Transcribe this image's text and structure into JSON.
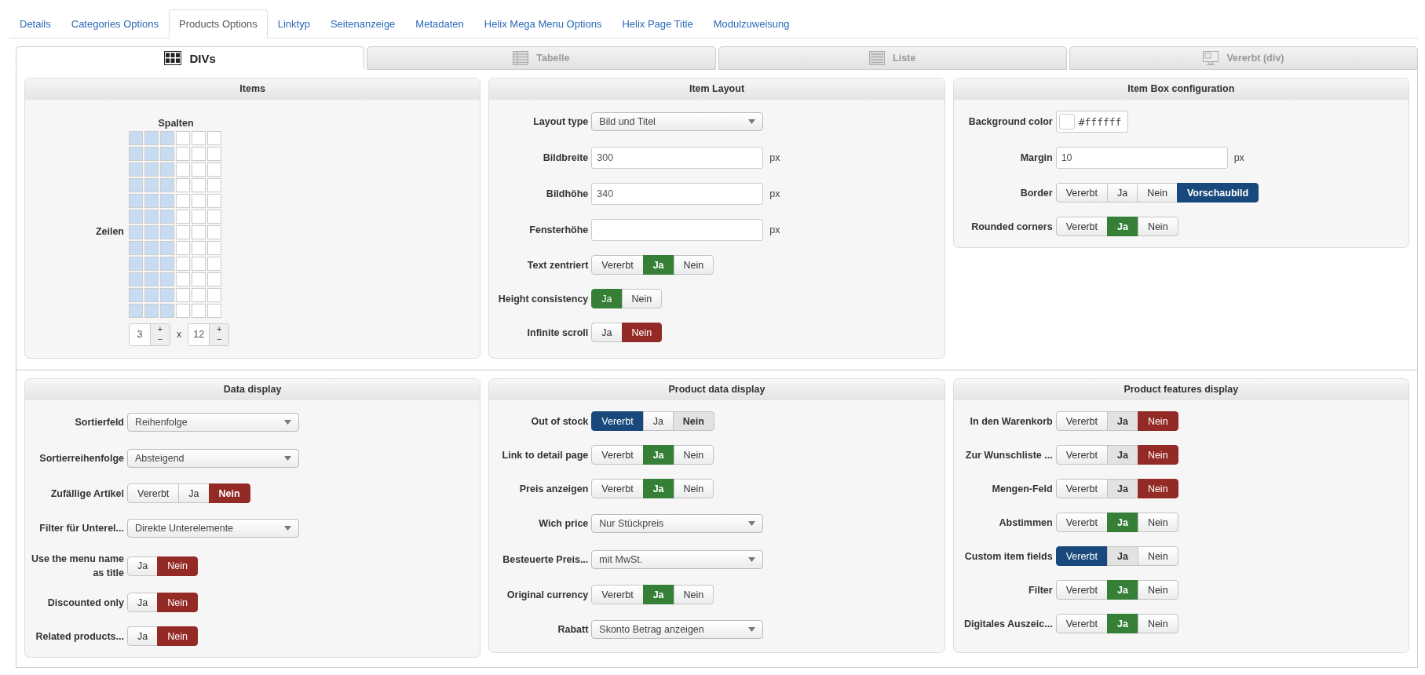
{
  "top_tabs": [
    {
      "label": "Details",
      "selected": false
    },
    {
      "label": "Categories Options",
      "selected": false
    },
    {
      "label": "Products Options",
      "selected": true
    },
    {
      "label": "Linktyp",
      "selected": false
    },
    {
      "label": "Seitenanzeige",
      "selected": false
    },
    {
      "label": "Metadaten",
      "selected": false
    },
    {
      "label": "Helix Mega Menu Options",
      "selected": false
    },
    {
      "label": "Helix Page Title",
      "selected": false
    },
    {
      "label": "Modulzuweisung",
      "selected": false
    }
  ],
  "view_tabs": [
    {
      "label": "DIVs",
      "kind": "divs",
      "selected": true
    },
    {
      "label": "Tabelle",
      "kind": "table",
      "selected": false
    },
    {
      "label": "Liste",
      "kind": "list",
      "selected": false
    },
    {
      "label": "Vererbt (div)",
      "kind": "inherit",
      "selected": false
    }
  ],
  "sections": [
    {
      "panels": [
        {
          "title": "Items",
          "kind": "grid",
          "columns_label": "Spalten",
          "rows_label": "Zeilen",
          "times": "x",
          "steppers": [
            {
              "value": "3",
              "plus": "+",
              "minus": "−"
            },
            {
              "value": "12",
              "plus": "+",
              "minus": "−"
            }
          ]
        },
        {
          "title": "Item Layout",
          "kind": "form",
          "fields": [
            {
              "label": "Layout type",
              "kind": "select",
              "value": "Bild und Titel"
            },
            {
              "label": "Bildbreite",
              "kind": "text",
              "value": "300",
              "unit": "px"
            },
            {
              "label": "Bildhöhe",
              "kind": "text",
              "value": "340",
              "unit": "px"
            },
            {
              "label": "Fensterhöhe",
              "kind": "text",
              "unit": "px"
            },
            {
              "label": "Text zentriert",
              "kind": "toggle",
              "options": [
                {
                  "label": "Vererbt",
                  "kind": "inherit",
                  "selected": false,
                  "inherited": false
                },
                {
                  "label": "Ja",
                  "kind": "yes",
                  "selected": true,
                  "inherited": true
                },
                {
                  "label": "Nein",
                  "kind": "no",
                  "selected": false,
                  "inherited": false
                }
              ]
            },
            {
              "label": "Height consistency",
              "kind": "toggle",
              "options": [
                {
                  "label": "Ja",
                  "kind": "yes",
                  "selected": true,
                  "inherited": false
                },
                {
                  "label": "Nein",
                  "kind": "no",
                  "selected": false,
                  "inherited": false
                }
              ]
            },
            {
              "label": "Infinite scroll",
              "kind": "toggle",
              "options": [
                {
                  "label": "Ja",
                  "kind": "yes",
                  "selected": false,
                  "inherited": false
                },
                {
                  "label": "Nein",
                  "kind": "no",
                  "selected": true,
                  "inherited": false
                }
              ]
            }
          ]
        },
        {
          "title": "Item Box configuration",
          "kind": "form",
          "fields": [
            {
              "label": "Background color",
              "kind": "color",
              "value": "#ffffff"
            },
            {
              "label": "Margin",
              "kind": "text",
              "value": "10",
              "unit": "px"
            },
            {
              "label": "Border",
              "kind": "toggle",
              "options": [
                {
                  "label": "Vererbt",
                  "kind": "inherit",
                  "selected": false,
                  "inherited": false
                },
                {
                  "label": "Ja",
                  "kind": "yes",
                  "selected": false,
                  "inherited": false
                },
                {
                  "label": "Nein",
                  "kind": "no",
                  "selected": false,
                  "inherited": false
                },
                {
                  "label": "Vorschaubild",
                  "kind": "preview",
                  "selected": true,
                  "inherited": true
                }
              ]
            },
            {
              "label": "Rounded corners",
              "kind": "toggle",
              "options": [
                {
                  "label": "Vererbt",
                  "kind": "inherit",
                  "selected": false,
                  "inherited": false
                },
                {
                  "label": "Ja",
                  "kind": "yes",
                  "selected": true,
                  "inherited": true
                },
                {
                  "label": "Nein",
                  "kind": "no",
                  "selected": false,
                  "inherited": false
                }
              ]
            }
          ]
        }
      ]
    },
    {
      "panels": [
        {
          "title": "Data display",
          "kind": "form",
          "fields": [
            {
              "label": "Sortierfeld",
              "kind": "select",
              "value": "Reihenfolge"
            },
            {
              "label": "Sortierreihenfolge",
              "kind": "select",
              "value": "Absteigend"
            },
            {
              "label": "Zufällige Artikel",
              "kind": "toggle",
              "options": [
                {
                  "label": "Vererbt",
                  "kind": "inherit",
                  "selected": false,
                  "inherited": false
                },
                {
                  "label": "Ja",
                  "kind": "yes",
                  "selected": false,
                  "inherited": false
                },
                {
                  "label": "Nein",
                  "kind": "no",
                  "selected": true,
                  "inherited": true
                }
              ]
            },
            {
              "label": "Filter für Unterel...",
              "kind": "select",
              "value": "Direkte Unterelemente"
            },
            {
              "label": "Use the menu name as title",
              "kind": "toggle",
              "options": [
                {
                  "label": "Ja",
                  "kind": "yes",
                  "selected": false,
                  "inherited": false
                },
                {
                  "label": "Nein",
                  "kind": "no",
                  "selected": true,
                  "inherited": false
                }
              ]
            },
            {
              "label": "Discounted only",
              "kind": "toggle",
              "options": [
                {
                  "label": "Ja",
                  "kind": "yes",
                  "selected": false,
                  "inherited": false
                },
                {
                  "label": "Nein",
                  "kind": "no",
                  "selected": true,
                  "inherited": false
                }
              ]
            },
            {
              "label": "Related products...",
              "kind": "toggle",
              "options": [
                {
                  "label": "Ja",
                  "kind": "yes",
                  "selected": false,
                  "inherited": false
                },
                {
                  "label": "Nein",
                  "kind": "no",
                  "selected": true,
                  "inherited": false
                }
              ]
            }
          ]
        },
        {
          "title": "Product data display",
          "kind": "form",
          "fields": [
            {
              "label": "Out of stock",
              "kind": "toggle",
              "options": [
                {
                  "label": "Vererbt",
                  "kind": "inherit",
                  "selected": true,
                  "inherited": false
                },
                {
                  "label": "Ja",
                  "kind": "yes",
                  "selected": false,
                  "inherited": false
                },
                {
                  "label": "Nein",
                  "kind": "no",
                  "selected": false,
                  "inherited": true
                }
              ]
            },
            {
              "label": "Link to detail page",
              "kind": "toggle",
              "options": [
                {
                  "label": "Vererbt",
                  "kind": "inherit",
                  "selected": false,
                  "inherited": false
                },
                {
                  "label": "Ja",
                  "kind": "yes",
                  "selected": true,
                  "inherited": true
                },
                {
                  "label": "Nein",
                  "kind": "no",
                  "selected": false,
                  "inherited": false
                }
              ]
            },
            {
              "label": "Preis anzeigen",
              "kind": "toggle",
              "options": [
                {
                  "label": "Vererbt",
                  "kind": "inherit",
                  "selected": false,
                  "inherited": false
                },
                {
                  "label": "Ja",
                  "kind": "yes",
                  "selected": true,
                  "inherited": true
                },
                {
                  "label": "Nein",
                  "kind": "no",
                  "selected": false,
                  "inherited": false
                }
              ]
            },
            {
              "label": "Wich price",
              "kind": "select",
              "value": "Nur Stückpreis"
            },
            {
              "label": "Besteuerte Preis...",
              "kind": "select",
              "value": "mit MwSt."
            },
            {
              "label": "Original currency",
              "kind": "toggle",
              "options": [
                {
                  "label": "Vererbt",
                  "kind": "inherit",
                  "selected": false,
                  "inherited": false
                },
                {
                  "label": "Ja",
                  "kind": "yes",
                  "selected": true,
                  "inherited": true
                },
                {
                  "label": "Nein",
                  "kind": "no",
                  "selected": false,
                  "inherited": false
                }
              ]
            },
            {
              "label": "Rabatt",
              "kind": "select",
              "value": "Skonto Betrag anzeigen"
            }
          ]
        },
        {
          "title": "Product features display",
          "kind": "form",
          "fields": [
            {
              "label": "In den Warenkorb",
              "kind": "toggle",
              "options": [
                {
                  "label": "Vererbt",
                  "kind": "inherit",
                  "selected": false,
                  "inherited": false
                },
                {
                  "label": "Ja",
                  "kind": "yes",
                  "selected": false,
                  "inherited": true
                },
                {
                  "label": "Nein",
                  "kind": "no",
                  "selected": true,
                  "inherited": false
                }
              ]
            },
            {
              "label": "Zur Wunschliste ...",
              "kind": "toggle",
              "options": [
                {
                  "label": "Vererbt",
                  "kind": "inherit",
                  "selected": false,
                  "inherited": false
                },
                {
                  "label": "Ja",
                  "kind": "yes",
                  "selected": false,
                  "inherited": true
                },
                {
                  "label": "Nein",
                  "kind": "no",
                  "selected": true,
                  "inherited": false
                }
              ]
            },
            {
              "label": "Mengen-Feld",
              "kind": "toggle",
              "options": [
                {
                  "label": "Vererbt",
                  "kind": "inherit",
                  "selected": false,
                  "inherited": false
                },
                {
                  "label": "Ja",
                  "kind": "yes",
                  "selected": false,
                  "inherited": true
                },
                {
                  "label": "Nein",
                  "kind": "no",
                  "selected": true,
                  "inherited": false
                }
              ]
            },
            {
              "label": "Abstimmen",
              "kind": "toggle",
              "options": [
                {
                  "label": "Vererbt",
                  "kind": "inherit",
                  "selected": false,
                  "inherited": false
                },
                {
                  "label": "Ja",
                  "kind": "yes",
                  "selected": true,
                  "inherited": true
                },
                {
                  "label": "Nein",
                  "kind": "no",
                  "selected": false,
                  "inherited": false
                }
              ]
            },
            {
              "label": "Custom item fields",
              "kind": "toggle",
              "options": [
                {
                  "label": "Vererbt",
                  "kind": "inherit",
                  "selected": true,
                  "inherited": false
                },
                {
                  "label": "Ja",
                  "kind": "yes",
                  "selected": false,
                  "inherited": true
                },
                {
                  "label": "Nein",
                  "kind": "no",
                  "selected": false,
                  "inherited": false
                }
              ]
            },
            {
              "label": "Filter",
              "kind": "toggle",
              "options": [
                {
                  "label": "Vererbt",
                  "kind": "inherit",
                  "selected": false,
                  "inherited": false
                },
                {
                  "label": "Ja",
                  "kind": "yes",
                  "selected": true,
                  "inherited": true
                },
                {
                  "label": "Nein",
                  "kind": "no",
                  "selected": false,
                  "inherited": false
                }
              ]
            },
            {
              "label": "Digitales Auszeic...",
              "kind": "toggle",
              "options": [
                {
                  "label": "Vererbt",
                  "kind": "inherit",
                  "selected": false,
                  "inherited": false
                },
                {
                  "label": "Ja",
                  "kind": "yes",
                  "selected": true,
                  "inherited": true
                },
                {
                  "label": "Nein",
                  "kind": "no",
                  "selected": false,
                  "inherited": false
                }
              ]
            }
          ]
        }
      ]
    }
  ]
}
